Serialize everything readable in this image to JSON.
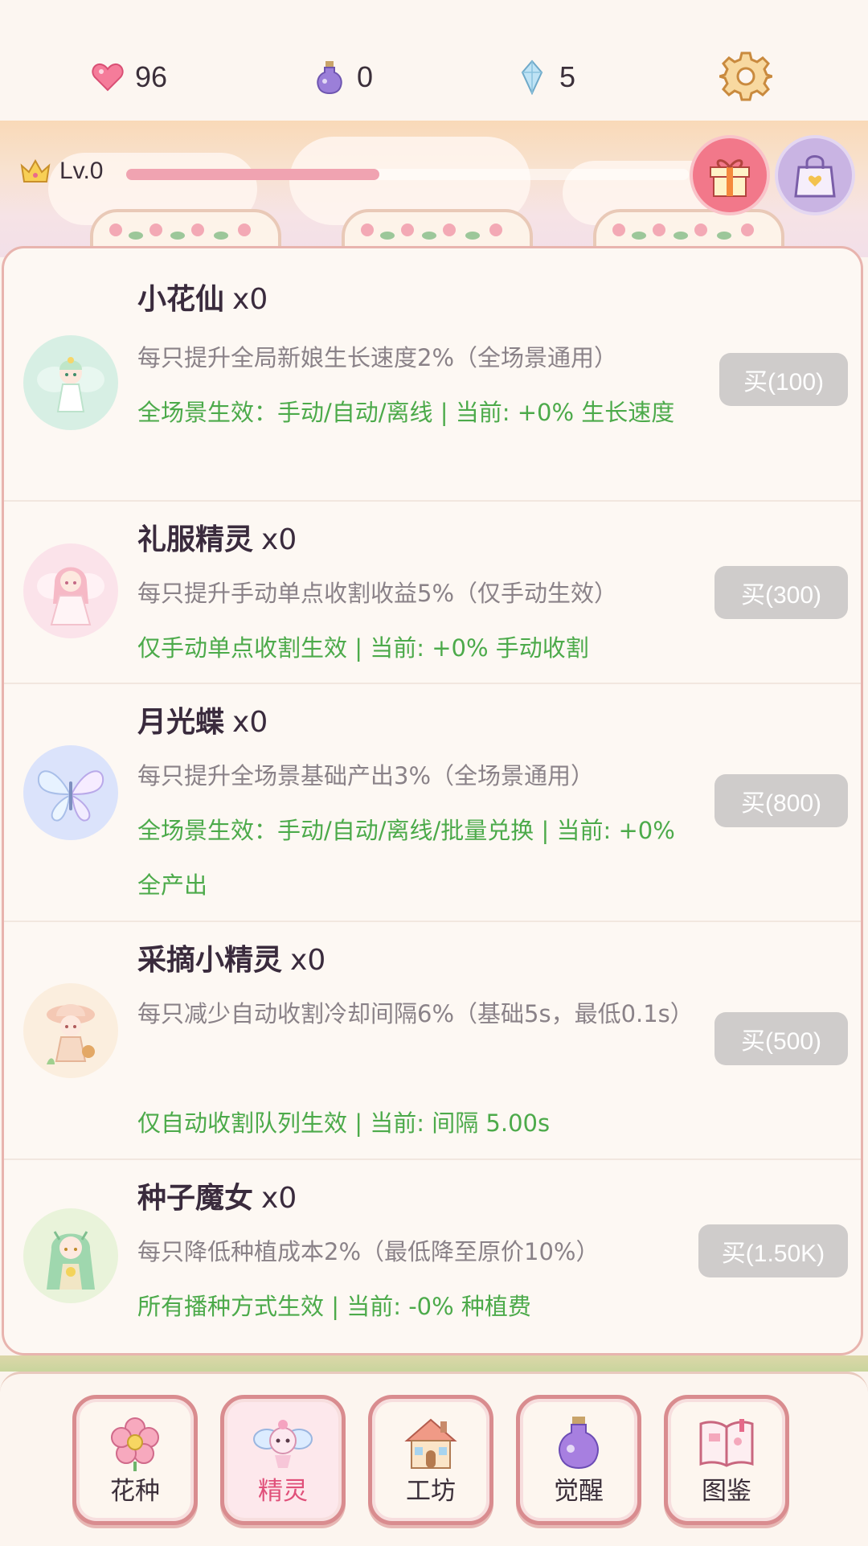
{
  "resources": {
    "hearts": "96",
    "potions": "0",
    "crystals": "5"
  },
  "level": {
    "label": "Lv.0",
    "progress": 0.45
  },
  "sprites": [
    {
      "name": "小花仙",
      "count": "x0",
      "description": "每只提升全局新娘生长速度2%（全场景通用）",
      "effect": "全场景生效：手动/自动/离线 | 当前: +0% 生长速度",
      "buy_label": "买(100)"
    },
    {
      "name": "礼服精灵",
      "count": "x0",
      "description": "每只提升手动单点收割收益5%（仅手动生效）",
      "effect": "仅手动单点收割生效 | 当前: +0% 手动收割",
      "buy_label": "买(300)"
    },
    {
      "name": "月光蝶",
      "count": "x0",
      "description": "每只提升全场景基础产出3%（全场景通用）",
      "effect": "全场景生效：手动/自动/离线/批量兑换 | 当前: +0% 全产出",
      "buy_label": "买(800)"
    },
    {
      "name": "采摘小精灵",
      "count": "x0",
      "description": "每只减少自动收割冷却间隔6%（基础5s，最低0.1s）",
      "effect": "仅自动收割队列生效 | 当前: 间隔 5.00s",
      "buy_label": "买(500)"
    },
    {
      "name": "种子魔女",
      "count": "x0",
      "description": "每只降低种植成本2%（最低降至原价10%）",
      "effect": "所有播种方式生效 | 当前: -0% 种植费",
      "buy_label": "买(1.50K)"
    }
  ],
  "nav": [
    {
      "label": "花种",
      "icon": "flower-icon"
    },
    {
      "label": "精灵",
      "icon": "fairy-icon"
    },
    {
      "label": "工坊",
      "icon": "house-icon"
    },
    {
      "label": "觉醒",
      "icon": "potion-icon"
    },
    {
      "label": "图鉴",
      "icon": "book-icon"
    }
  ],
  "colors": {
    "effect_green": "#4caa4a",
    "active_tab_text": "#e0507a",
    "panel_border": "#e8b4ae",
    "buy_button_disabled": "#cfcccb"
  }
}
